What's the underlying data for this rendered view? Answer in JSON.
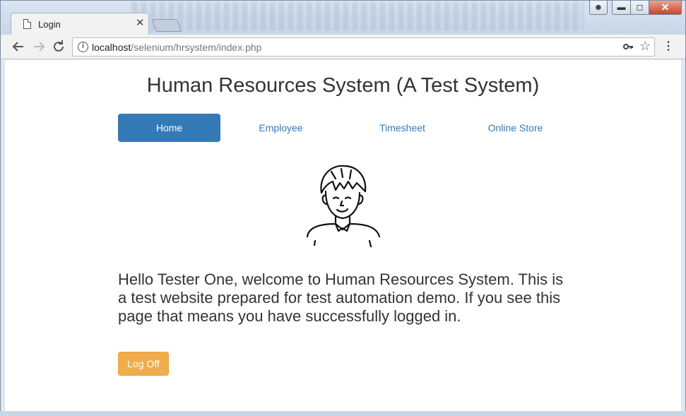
{
  "browser": {
    "tab_title": "Login",
    "tab_close": "✕",
    "url_host": "localhost",
    "url_path": "/selenium/hrsystem/index.php",
    "icons": {
      "page": "document-icon",
      "info": "info-icon",
      "key": "key-icon",
      "star": "star-icon",
      "menu": "kebab-menu-icon"
    }
  },
  "page": {
    "title": "Human Resources System (A Test System)",
    "nav": [
      {
        "label": "Home",
        "active": true
      },
      {
        "label": "Employee",
        "active": false
      },
      {
        "label": "Timesheet",
        "active": false
      },
      {
        "label": "Online Store",
        "active": false
      }
    ],
    "welcome_text": "Hello Tester One, welcome to Human Resources System. This is a test website prepared for test automation demo. If you see this page that means you have successfully logged in.",
    "logoff_label": "Log Off"
  },
  "colors": {
    "primary": "#337ab7",
    "warning": "#f0ad4e",
    "text": "#333333"
  }
}
